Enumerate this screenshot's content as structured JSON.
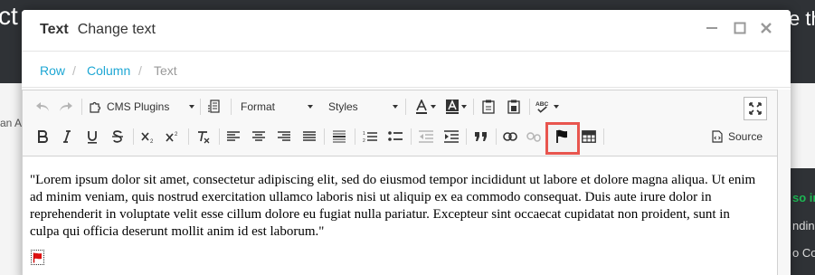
{
  "background": {
    "left_heading_fragment": "ct",
    "right_heading_fragment": "e th",
    "side_fragment": "an A",
    "right_panel": [
      "so in",
      "ndin",
      "o Co"
    ]
  },
  "modal": {
    "title_bold": "Text",
    "title": "Change text",
    "minimize": "—",
    "maximize": "☐",
    "close": "✕"
  },
  "breadcrumb": {
    "row": "Row",
    "sep": "/",
    "column": "Column",
    "current": "Text"
  },
  "toolbar": {
    "cms_plugins": "CMS Plugins",
    "format": "Format",
    "styles": "Styles",
    "source": "Source",
    "spell_label": "ABC",
    "highlight_color": "#e8554e"
  },
  "content": {
    "paragraph": "\"Lorem ipsum dolor sit amet, consectetur adipiscing elit, sed do eiusmod tempor incididunt ut labore et dolore magna aliqua. Ut enim ad minim veniam, quis nostrud exercitation ullamco laboris nisi ut aliquip ex ea commodo consequat. Duis aute irure dolor in reprehenderit in voluptate velit esse cillum dolore eu fugiat nulla pariatur. Excepteur sint occaecat cupidatat non proident, sunt in culpa qui officia deserunt mollit anim id est laborum.\""
  }
}
